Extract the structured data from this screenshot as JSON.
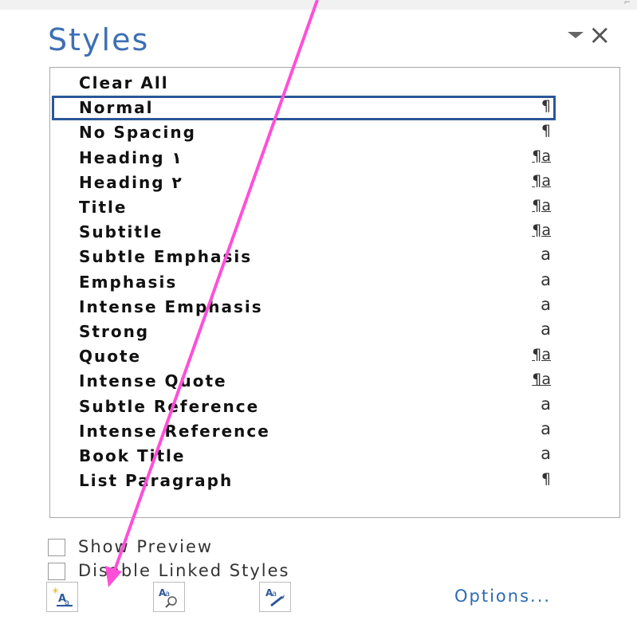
{
  "pane": {
    "title": "Styles",
    "menu_icon": "dropdown-arrow-icon",
    "close_icon": "close-icon"
  },
  "styles": [
    {
      "name": "Clear All",
      "indicator": "",
      "kind": "none"
    },
    {
      "name": "Normal",
      "indicator": "¶",
      "kind": "paragraph",
      "selected": true
    },
    {
      "name": "No Spacing",
      "indicator": "¶",
      "kind": "paragraph"
    },
    {
      "name": "Heading ١",
      "indicator": "¶a",
      "kind": "linked"
    },
    {
      "name": "Heading ٢",
      "indicator": "¶a",
      "kind": "linked"
    },
    {
      "name": "Title",
      "indicator": "¶a",
      "kind": "linked"
    },
    {
      "name": "Subtitle",
      "indicator": "¶a",
      "kind": "linked"
    },
    {
      "name": "Subtle Emphasis",
      "indicator": "a",
      "kind": "character"
    },
    {
      "name": "Emphasis",
      "indicator": "a",
      "kind": "character"
    },
    {
      "name": "Intense Emphasis",
      "indicator": "a",
      "kind": "character"
    },
    {
      "name": "Strong",
      "indicator": "a",
      "kind": "character"
    },
    {
      "name": "Quote",
      "indicator": "¶a",
      "kind": "linked"
    },
    {
      "name": "Intense Quote",
      "indicator": "¶a",
      "kind": "linked"
    },
    {
      "name": "Subtle Reference",
      "indicator": "a",
      "kind": "character"
    },
    {
      "name": "Intense Reference",
      "indicator": "a",
      "kind": "character"
    },
    {
      "name": "Book Title",
      "indicator": "a",
      "kind": "character"
    },
    {
      "name": "List Paragraph",
      "indicator": "¶",
      "kind": "paragraph"
    }
  ],
  "options": {
    "show_preview_label": "Show Preview",
    "show_preview_checked": false,
    "disable_linked_label": "Disable Linked Styles",
    "disable_linked_checked": false
  },
  "footer": {
    "new_style_icon": "new-style-icon",
    "style_inspector_icon": "style-inspector-icon",
    "manage_styles_icon": "manage-styles-icon",
    "options_label": "Options..."
  },
  "colors": {
    "accent": "#3d6fb4",
    "selection_border": "#2b579a",
    "annotation_arrow": "#ff4fd8"
  }
}
